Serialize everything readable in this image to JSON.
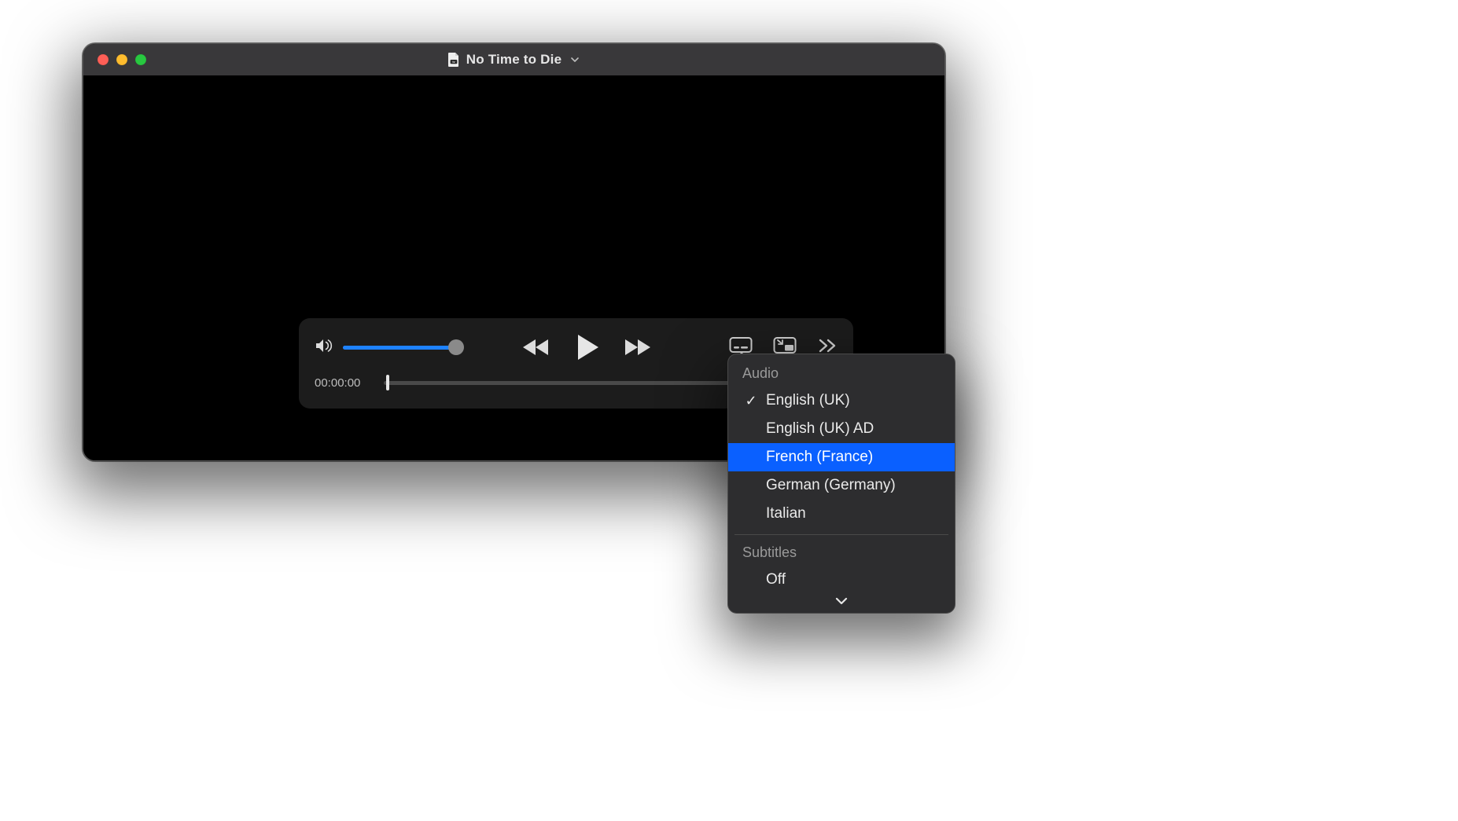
{
  "window": {
    "title": "No Time to Die"
  },
  "player": {
    "time_current": "00:00:00",
    "timeline_progress_percent": 0.5,
    "volume_percent": 95
  },
  "popover": {
    "audio_section_label": "Audio",
    "audio_selected_index": 0,
    "audio_highlight_index": 2,
    "audio_items": [
      {
        "label": "English (UK)"
      },
      {
        "label": "English (UK) AD"
      },
      {
        "label": "French (France)"
      },
      {
        "label": "German (Germany)"
      },
      {
        "label": "Italian"
      }
    ],
    "subtitles_section_label": "Subtitles",
    "subtitles_items": [
      {
        "label": "Off"
      }
    ]
  },
  "colors": {
    "accent_blue": "#0a60ff",
    "slider_blue": "#1e82ff"
  }
}
